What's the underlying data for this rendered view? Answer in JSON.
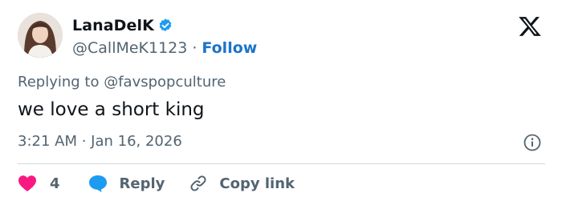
{
  "author": {
    "display_name": "LanaDelK",
    "handle": "@CallMeK1123",
    "separator": "·",
    "follow_label": "Follow",
    "verified": true,
    "avatar_icon": "profile-photo"
  },
  "tweet": {
    "replying_to": "Replying to @favspopculture",
    "text": "we love a short king",
    "timestamp": "3:21 AM · Jan 16, 2026"
  },
  "actions": {
    "like_count": "4",
    "reply_label": "Reply",
    "copy_link_label": "Copy link"
  },
  "icons": {
    "brand": "x-logo-icon",
    "like": "heart-icon",
    "reply": "speech-bubble-icon",
    "copy": "link-icon",
    "info": "info-icon",
    "verified": "verified-badge-icon"
  },
  "colors": {
    "text": "#0f1419",
    "muted": "#536471",
    "accent": "#1d74c8",
    "like": "#f91880",
    "reply_icon": "#1d9bf0",
    "verified": "#1d9bf0",
    "divider": "#cfd9de"
  }
}
